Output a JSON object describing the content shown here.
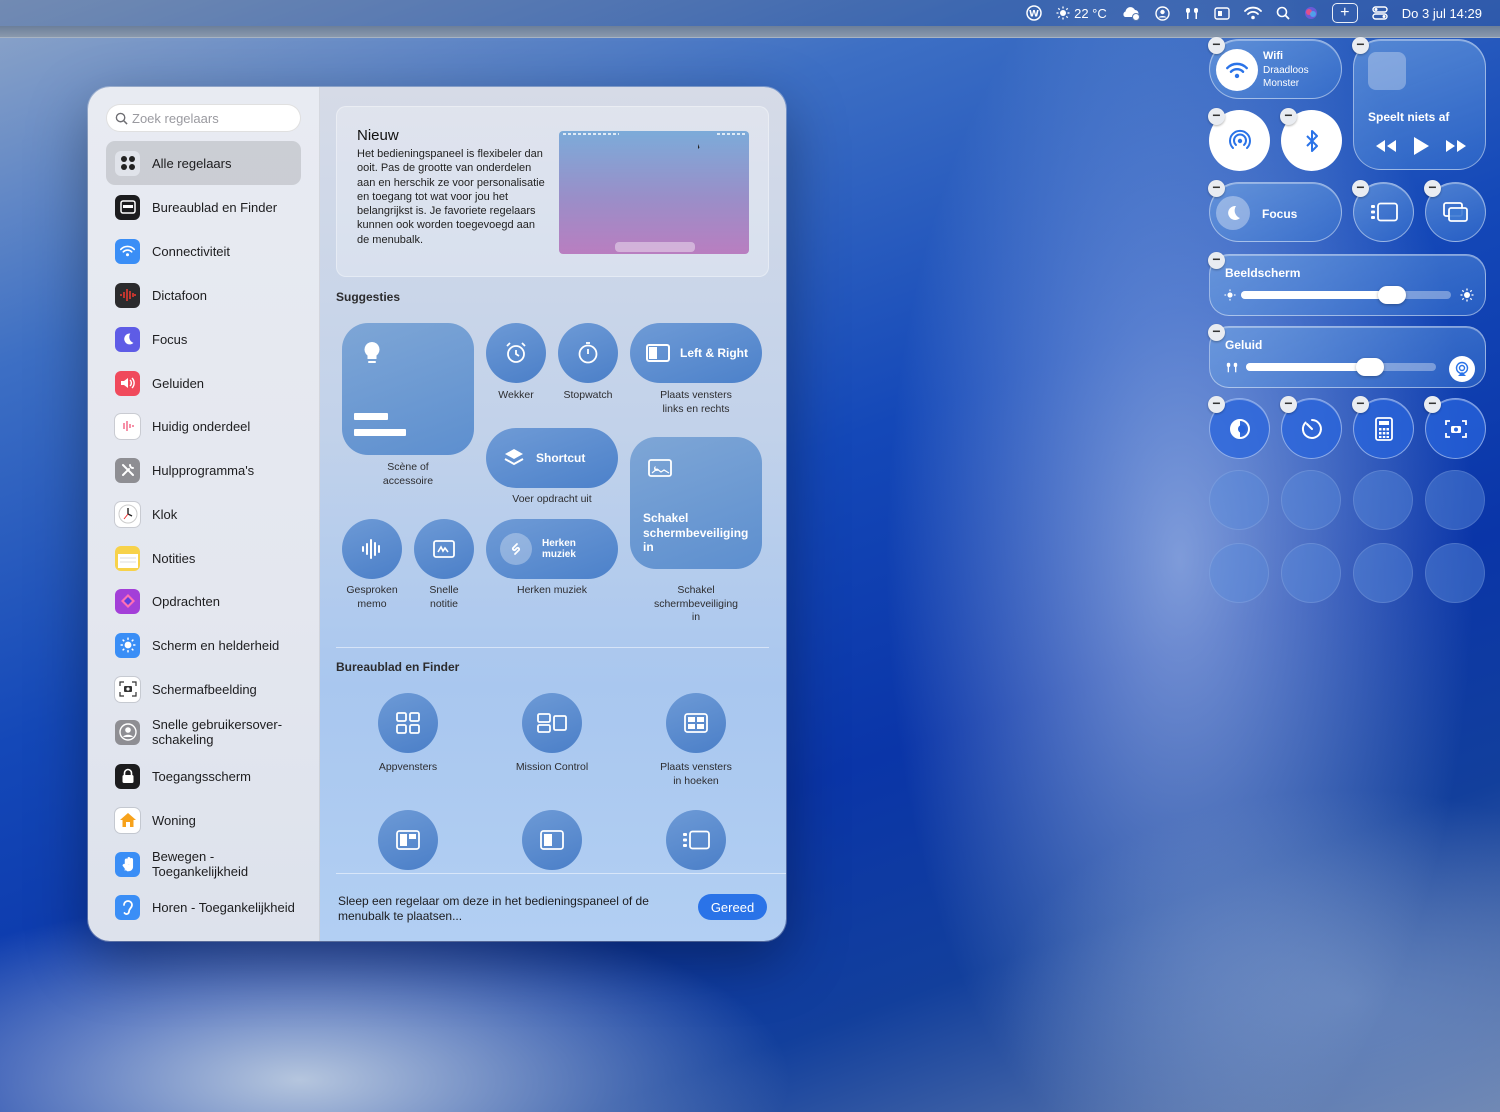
{
  "menubar": {
    "weather": "22 °C",
    "datetime": "Do 3 jul  14:29",
    "plus": "+"
  },
  "gallery": {
    "search": {
      "placeholder": "Zoek regelaars"
    },
    "sidebar": [
      {
        "label": "Alle regelaars",
        "icon": "grid-icon",
        "color": "#e0e3ea"
      },
      {
        "label": "Bureaublad en Finder",
        "icon": "desktop-icon",
        "color": "#1c1c1e"
      },
      {
        "label": "Connectiviteit",
        "icon": "wifi-icon",
        "color": "#3a8ef6"
      },
      {
        "label": "Dictafoon",
        "icon": "waveform-icon",
        "color": "#2b2b2d"
      },
      {
        "label": "Focus",
        "icon": "moon-icon",
        "color": "#5e5ce6"
      },
      {
        "label": "Geluiden",
        "icon": "speaker-icon",
        "color": "#f04a5c"
      },
      {
        "label": "Huidig onderdeel",
        "icon": "music-bars-icon",
        "color": "#ffffff"
      },
      {
        "label": "Hulpprogramma's",
        "icon": "tools-icon",
        "color": "#8e8e93"
      },
      {
        "label": "Klok",
        "icon": "clock-icon",
        "color": "#ffffff"
      },
      {
        "label": "Notities",
        "icon": "notes-icon",
        "color": "#f7d24a"
      },
      {
        "label": "Opdrachten",
        "icon": "shortcuts-icon",
        "color": "#a33fd8"
      },
      {
        "label": "Scherm en helderheid",
        "icon": "sun-icon",
        "color": "#3a8ef6"
      },
      {
        "label": "Schermafbeelding",
        "icon": "camera-icon",
        "color": "#ffffff"
      },
      {
        "label": "Snelle gebruikersover-\nschakeling",
        "icon": "user-icon",
        "color": "#8e8e93"
      },
      {
        "label": "Toegangsscherm",
        "icon": "lock-icon",
        "color": "#1c1c1e"
      },
      {
        "label": "Woning",
        "icon": "home-icon",
        "color": "#ffffff"
      },
      {
        "label": "Bewegen -\nToegankelijkheid",
        "icon": "hand-icon",
        "color": "#3a8ef6"
      },
      {
        "label": "Horen - Toegankelijkheid",
        "icon": "ear-icon",
        "color": "#3a8ef6"
      }
    ],
    "new": {
      "title": "Nieuw",
      "description": "Het bedieningspaneel is flexibeler dan ooit. Pas de grootte van onderdelen aan en herschik ze voor personalisatie en toegang tot wat voor jou het belangrijkst is. Je favoriete regelaars kunnen ook worden toegevoegd aan de menubalk."
    },
    "suggestions": {
      "title": "Suggesties",
      "scene": "Scène of\naccessoire",
      "wekker": "Wekker",
      "stopwatch": "Stopwatch",
      "leftright_tile": "Left & Right",
      "leftright_label": "Plaats vensters\nlinks en rechts",
      "shortcut_tile": "Shortcut",
      "shortcut_label": "Voer opdracht uit",
      "screensaver_tile": "Schakel\nschermbeveiliging\nin",
      "screensaver_label": "Schakel\nschermbeveiliging\nin",
      "memo": "Gesproken\nmemo",
      "note": "Snelle\nnotitie",
      "music_tile": "Herken\nmuziek",
      "music_label": "Herken muziek"
    },
    "desktop": {
      "title": "Bureaublad en Finder",
      "items": [
        "Appvensters",
        "Mission Control",
        "Plaats vensters\nin hoeken"
      ]
    },
    "footer": {
      "text": "Sleep een regelaar om deze in het bedieningspaneel of de menubalk te plaatsen...",
      "done": "Gereed"
    }
  },
  "control_center": {
    "wifi_title": "Wifi",
    "wifi_sub": "Draadloos\nMonster",
    "nowplaying": "Speelt niets af",
    "focus": "Focus",
    "display": "Beeldscherm",
    "display_level": 0.72,
    "sound": "Geluid",
    "sound_level": 0.65,
    "accent": "#2a73e8"
  }
}
